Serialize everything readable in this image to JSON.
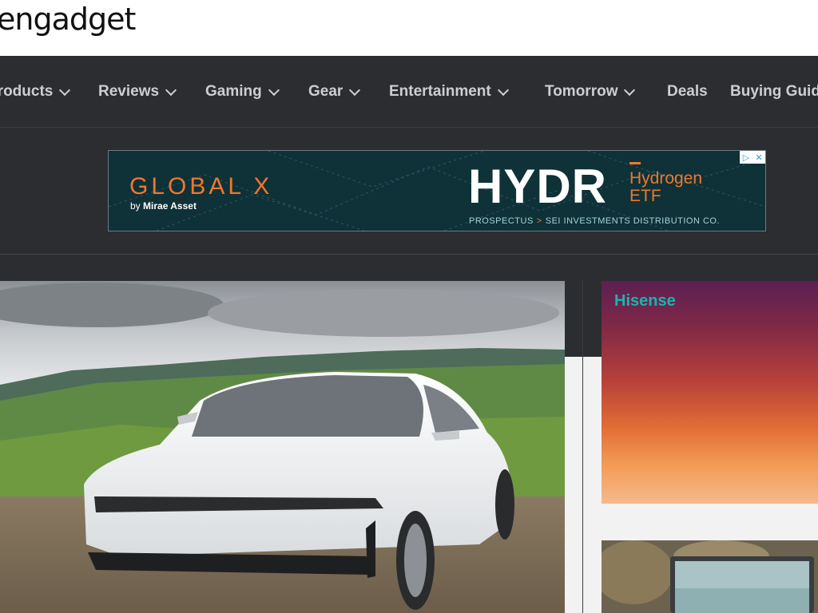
{
  "header": {
    "logo": "engadget"
  },
  "nav": {
    "items": [
      {
        "label": "Products",
        "has_dropdown": true
      },
      {
        "label": "Reviews",
        "has_dropdown": true
      },
      {
        "label": "Gaming",
        "has_dropdown": true
      },
      {
        "label": "Gear",
        "has_dropdown": true
      },
      {
        "label": "Entertainment",
        "has_dropdown": true
      },
      {
        "label": "Tomorrow",
        "has_dropdown": true
      },
      {
        "label": "Deals",
        "has_dropdown": false
      },
      {
        "label": "Buying Guides",
        "has_dropdown": false
      }
    ]
  },
  "ad_banner": {
    "brand": "GLOBAL X",
    "byline_prefix": "by",
    "byline_company": "Mirae Asset",
    "ticker": "HYDR",
    "product_line1": "Hydrogen",
    "product_line2": "ETF",
    "prospectus": "PROSPECTUS",
    "distributor": "SEI INVESTMENTS DISTRIBUTION CO.",
    "icons": [
      "adchoices-icon",
      "close-icon"
    ]
  },
  "side_ad": {
    "brand": "Hisense"
  },
  "colors": {
    "nav_bg": "#2c2d31",
    "nav_text": "#cdced2",
    "accent_orange": "#f0772c",
    "ad_bg": "#0f3138",
    "hisense_teal": "#18b5b0"
  }
}
